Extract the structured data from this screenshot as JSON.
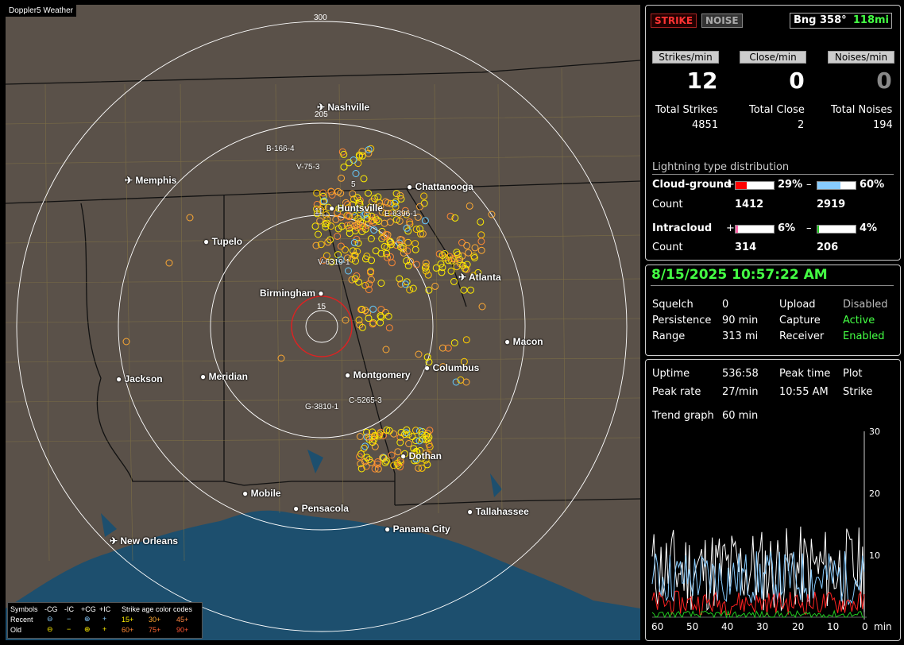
{
  "map": {
    "title": "Doppler5 Weather",
    "range_rings": [
      "300",
      "205",
      "15"
    ],
    "cities": {
      "nashville": "Nashville",
      "memphis": "Memphis",
      "chattanooga": "Chattanooga",
      "huntsville": "Huntsville",
      "tupelo": "Tupelo",
      "atlanta": "Atlanta",
      "birmingham": "Birmingham",
      "macon": "Macon",
      "jackson": "Jackson",
      "meridian": "Meridian",
      "montgomery": "Montgomery",
      "columbus": "Columbus",
      "dothan": "Dothan",
      "mobile": "Mobile",
      "pensacola": "Pensacola",
      "tallahassee": "Tallahassee",
      "panama_city": "Panama City",
      "new_orleans": "New Orleans"
    },
    "storm_labels": {
      "b166": "B-166-4",
      "v75": "V-75-3",
      "s15": "5",
      "s11": "11",
      "e6396": "E-6396-1",
      "v6319": "V-6319-1",
      "c5265": "C-5265-3",
      "g3810": "G-3810-1"
    },
    "legend": {
      "symbols": "Symbols",
      "neg_cg": "-CG",
      "neg_ic": "-IC",
      "pos_cg": "+CG",
      "pos_ic": "+IC",
      "age_codes": "Strike age color codes",
      "recent": "Recent",
      "old": "Old",
      "a15": "15+",
      "a30": "30+",
      "a45": "45+",
      "a60": "60+",
      "a75": "75+",
      "a90": "90+"
    }
  },
  "header": {
    "strike_btn": "STRIKE",
    "noise_btn": "NOISE",
    "bearing": "Bng 358°",
    "bearing_range": "118mi"
  },
  "rates": {
    "strikes_label": "Strikes/min",
    "close_label": "Close/min",
    "noises_label": "Noises/min",
    "strikes_val": "12",
    "close_val": "0",
    "noises_val": "0",
    "total_strikes_label": "Total Strikes",
    "total_close_label": "Total Close",
    "total_noises_label": "Total Noises",
    "total_strikes": "4851",
    "total_close": "2",
    "total_noises": "194"
  },
  "distribution": {
    "title": "Lightning type distribution",
    "cg_label": "Cloud-ground",
    "ic_label": "Intracloud",
    "count_label": "Count",
    "plus": "+",
    "minus": "–",
    "cg_pos_pct": "29%",
    "cg_neg_pct": "60%",
    "cg_pos_count": "1412",
    "cg_neg_count": "2919",
    "ic_pos_pct": "6%",
    "ic_neg_pct": "4%",
    "ic_pos_count": "314",
    "ic_neg_count": "206",
    "cg_pos_frac": 0.29,
    "cg_neg_frac": 0.6,
    "ic_pos_frac": 0.06,
    "ic_neg_frac": 0.04
  },
  "status": {
    "datetime": "8/15/2025 10:57:22 AM",
    "squelch_label": "Squelch",
    "squelch": "0",
    "upload_label": "Upload",
    "upload": "Disabled",
    "persistence_label": "Persistence",
    "persistence": "90 min",
    "capture_label": "Capture",
    "capture": "Active",
    "range_label": "Range",
    "range": "313 mi",
    "receiver_label": "Receiver",
    "receiver": "Enabled"
  },
  "trend": {
    "uptime_label": "Uptime",
    "uptime": "536:58",
    "peak_time_label": "Peak time",
    "plot_label": "Plot",
    "peak_rate_label": "Peak rate",
    "peak_rate": "27/min",
    "peak_time": "10:55 AM",
    "plot": "Strike",
    "graph_label": "Trend graph",
    "graph_span": "60 min",
    "y_ticks": [
      "30",
      "20",
      "10"
    ],
    "x_ticks": [
      "60",
      "50",
      "40",
      "30",
      "20",
      "10",
      "0"
    ],
    "x_unit": "min"
  },
  "colors": {
    "map_bg": "#5a5149",
    "water": "#1d4f6e",
    "accent_green": "#44ff44",
    "strike_red": "#cc2222",
    "cg_pos": "#ff0000",
    "cg_neg": "#88ccff",
    "ic_pos": "#ff66aa",
    "ic_neg": "#22cc22"
  }
}
